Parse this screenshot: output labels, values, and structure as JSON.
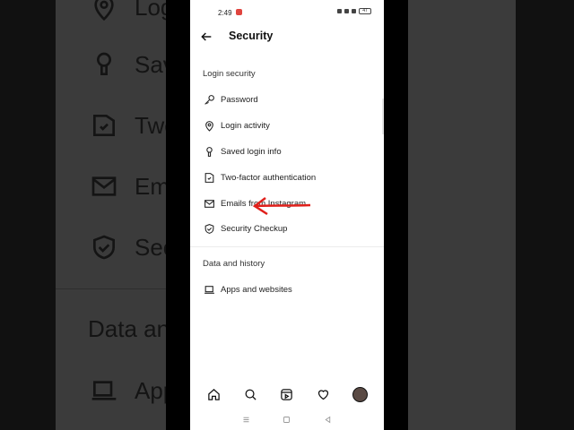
{
  "statusbar": {
    "time": "2:49",
    "battery": "47"
  },
  "header": {
    "title": "Security"
  },
  "sections": {
    "login_security": {
      "title": "Login security",
      "items": [
        {
          "label": "Password",
          "icon": "key-icon"
        },
        {
          "label": "Login activity",
          "icon": "location-pin-icon"
        },
        {
          "label": "Saved login info",
          "icon": "keyhole-icon"
        },
        {
          "label": "Two-factor authentication",
          "icon": "shield-badge-icon"
        },
        {
          "label": "Emails from Instagram",
          "icon": "mail-icon"
        },
        {
          "label": "Security Checkup",
          "icon": "shield-check-icon"
        }
      ]
    },
    "data_history": {
      "title": "Data and history",
      "items": [
        {
          "label": "Apps and websites",
          "icon": "laptop-icon"
        }
      ]
    }
  },
  "background": {
    "items": [
      "Login",
      "Saved",
      "Two",
      "Ema",
      "Secu",
      "Data and",
      "App"
    ]
  },
  "colors": {
    "arrow": "#e0201b",
    "notification": "#e0443e"
  }
}
